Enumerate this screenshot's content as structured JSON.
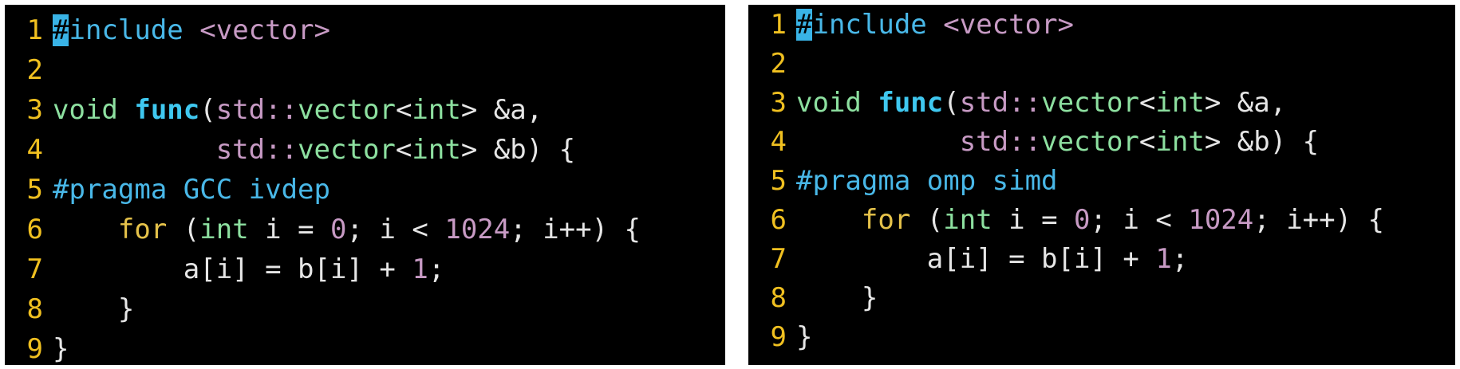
{
  "colors": {
    "background": "#000000",
    "line_number": "#f0c020",
    "cursor": "#39b3e6",
    "type_keyword": "#8de0a0",
    "control_keyword": "#e5c24a",
    "function_name": "#3fc8f0",
    "namespace_and_numbers": "#c79ac4",
    "preprocessor": "#49b8e8"
  },
  "panes": [
    {
      "id": "left",
      "lines": [
        {
          "n": "1",
          "tokens": [
            {
              "t": "#",
              "c": "cursor"
            },
            {
              "t": "include ",
              "c": "pre"
            },
            {
              "t": "<vector>",
              "c": "str"
            }
          ]
        },
        {
          "n": "2",
          "tokens": []
        },
        {
          "n": "3",
          "tokens": [
            {
              "t": "void ",
              "c": "kw-type"
            },
            {
              "t": "func",
              "c": "fn"
            },
            {
              "t": "(",
              "c": "plain"
            },
            {
              "t": "std",
              "c": "ns"
            },
            {
              "t": "::",
              "c": "ns"
            },
            {
              "t": "vector",
              "c": "kw-type"
            },
            {
              "t": "<",
              "c": "plain"
            },
            {
              "t": "int",
              "c": "kw-type"
            },
            {
              "t": "> &a,",
              "c": "plain"
            }
          ]
        },
        {
          "n": "4",
          "tokens": [
            {
              "t": "          ",
              "c": "plain"
            },
            {
              "t": "std",
              "c": "ns"
            },
            {
              "t": "::",
              "c": "ns"
            },
            {
              "t": "vector",
              "c": "kw-type"
            },
            {
              "t": "<",
              "c": "plain"
            },
            {
              "t": "int",
              "c": "kw-type"
            },
            {
              "t": "> &b) {",
              "c": "plain"
            }
          ]
        },
        {
          "n": "5",
          "tokens": [
            {
              "t": "#pragma GCC ivdep",
              "c": "pre"
            }
          ]
        },
        {
          "n": "6",
          "tokens": [
            {
              "t": "    ",
              "c": "plain"
            },
            {
              "t": "for",
              "c": "kw-ctrl"
            },
            {
              "t": " (",
              "c": "plain"
            },
            {
              "t": "int",
              "c": "kw-type"
            },
            {
              "t": " i = ",
              "c": "plain"
            },
            {
              "t": "0",
              "c": "num"
            },
            {
              "t": "; i < ",
              "c": "plain"
            },
            {
              "t": "1024",
              "c": "num"
            },
            {
              "t": "; i++) {",
              "c": "plain"
            }
          ]
        },
        {
          "n": "7",
          "tokens": [
            {
              "t": "        a[i] = b[i] + ",
              "c": "plain"
            },
            {
              "t": "1",
              "c": "num"
            },
            {
              "t": ";",
              "c": "plain"
            }
          ]
        },
        {
          "n": "8",
          "tokens": [
            {
              "t": "    }",
              "c": "plain"
            }
          ]
        },
        {
          "n": "9",
          "tokens": [
            {
              "t": "}",
              "c": "plain"
            }
          ]
        }
      ]
    },
    {
      "id": "right",
      "lines": [
        {
          "n": "1",
          "tokens": [
            {
              "t": "#",
              "c": "cursor"
            },
            {
              "t": "include ",
              "c": "pre"
            },
            {
              "t": "<vector>",
              "c": "str"
            }
          ]
        },
        {
          "n": "2",
          "tokens": []
        },
        {
          "n": "3",
          "tokens": [
            {
              "t": "void ",
              "c": "kw-type"
            },
            {
              "t": "func",
              "c": "fn"
            },
            {
              "t": "(",
              "c": "plain"
            },
            {
              "t": "std",
              "c": "ns"
            },
            {
              "t": "::",
              "c": "ns"
            },
            {
              "t": "vector",
              "c": "kw-type"
            },
            {
              "t": "<",
              "c": "plain"
            },
            {
              "t": "int",
              "c": "kw-type"
            },
            {
              "t": "> &a,",
              "c": "plain"
            }
          ]
        },
        {
          "n": "4",
          "tokens": [
            {
              "t": "          ",
              "c": "plain"
            },
            {
              "t": "std",
              "c": "ns"
            },
            {
              "t": "::",
              "c": "ns"
            },
            {
              "t": "vector",
              "c": "kw-type"
            },
            {
              "t": "<",
              "c": "plain"
            },
            {
              "t": "int",
              "c": "kw-type"
            },
            {
              "t": "> &b) {",
              "c": "plain"
            }
          ]
        },
        {
          "n": "5",
          "tokens": [
            {
              "t": "#pragma omp simd",
              "c": "pre"
            }
          ]
        },
        {
          "n": "6",
          "tokens": [
            {
              "t": "    ",
              "c": "plain"
            },
            {
              "t": "for",
              "c": "kw-ctrl"
            },
            {
              "t": " (",
              "c": "plain"
            },
            {
              "t": "int",
              "c": "kw-type"
            },
            {
              "t": " i = ",
              "c": "plain"
            },
            {
              "t": "0",
              "c": "num"
            },
            {
              "t": "; i < ",
              "c": "plain"
            },
            {
              "t": "1024",
              "c": "num"
            },
            {
              "t": "; i++) {",
              "c": "plain"
            }
          ]
        },
        {
          "n": "7",
          "tokens": [
            {
              "t": "        a[i] = b[i] + ",
              "c": "plain"
            },
            {
              "t": "1",
              "c": "num"
            },
            {
              "t": ";",
              "c": "plain"
            }
          ]
        },
        {
          "n": "8",
          "tokens": [
            {
              "t": "    }",
              "c": "plain"
            }
          ]
        },
        {
          "n": "9",
          "tokens": [
            {
              "t": "}",
              "c": "plain"
            }
          ]
        }
      ]
    }
  ]
}
